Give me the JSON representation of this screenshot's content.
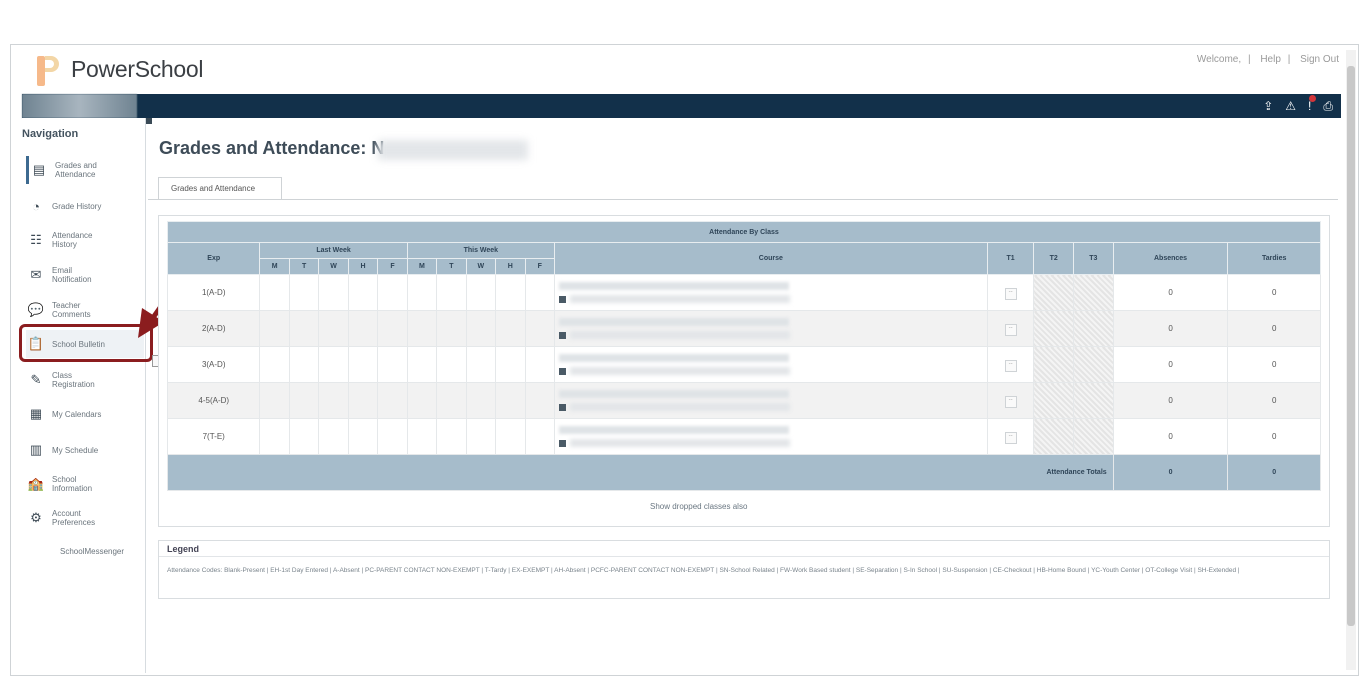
{
  "header": {
    "brand": "PowerSchool",
    "welcome": "Welcome,",
    "welcome_name": "",
    "help": "Help",
    "sign_out": "Sign Out"
  },
  "sidebar": {
    "title": "Navigation",
    "items": [
      {
        "label": "Grades and Attendance",
        "icon": "grades-icon"
      },
      {
        "label": "Grade History",
        "icon": "history-icon"
      },
      {
        "label": "Attendance History",
        "icon": "attendance-icon"
      },
      {
        "label": "Email Notification",
        "icon": "email-icon"
      },
      {
        "label": "Teacher Comments",
        "icon": "comments-icon"
      },
      {
        "label": "School Bulletin",
        "icon": "bulletin-icon"
      },
      {
        "label": "Class Registration",
        "icon": "registration-icon"
      },
      {
        "label": "My Calendars",
        "icon": "calendar-icon"
      },
      {
        "label": "My Schedule",
        "icon": "schedule-icon"
      },
      {
        "label": "School Information",
        "icon": "school-icon"
      },
      {
        "label": "Account Preferences",
        "icon": "account-icon"
      }
    ],
    "footer": "SchoolMessenger"
  },
  "main": {
    "title": "Grades and Attendance: N",
    "tab": "Grades and Attendance",
    "table": {
      "caption": "Attendance By Class",
      "exp_header": "Exp",
      "last_week": "Last Week",
      "this_week": "This Week",
      "days": [
        "M",
        "T",
        "W",
        "H",
        "F",
        "M",
        "T",
        "W",
        "H",
        "F"
      ],
      "course_header": "Course",
      "term_headers": [
        "T1",
        "T2",
        "T3"
      ],
      "absences_header": "Absences",
      "tardies_header": "Tardies",
      "rows": [
        {
          "exp": "1(A-D)",
          "t1": "--",
          "absences": "0",
          "tardies": "0"
        },
        {
          "exp": "2(A-D)",
          "t1": "--",
          "absences": "0",
          "tardies": "0"
        },
        {
          "exp": "3(A-D)",
          "t1": "--",
          "absences": "0",
          "tardies": "0"
        },
        {
          "exp": "4-5(A-D)",
          "t1": "--",
          "absences": "0",
          "tardies": "0"
        },
        {
          "exp": "7(T-E)",
          "t1": "--",
          "absences": "0",
          "tardies": "0"
        }
      ],
      "totals_label": "Attendance Totals",
      "total_absences": "0",
      "total_tardies": "0"
    },
    "dropped_link": "Show dropped classes also"
  },
  "legend": {
    "title": "Legend",
    "text": "Attendance Codes: Blank-Present | EH-1st Day Entered | A-Absent | PC-PARENT CONTACT NON-EXEMPT | T-Tardy | EX-EXEMPT | AH-Absent | PCFC-PARENT CONTACT NON-EXEMPT | SN-School Related | FW-Work Based student | SE-Separation | S-In School | SU-Suspension | CE-Checkout | HB-Home Bound | YC-Youth Center | OT-College Visit | SH-Extended |"
  },
  "colors": {
    "topbar": "#12304a",
    "table_header": "#a6bccb",
    "highlight": "#8b1d1f"
  }
}
